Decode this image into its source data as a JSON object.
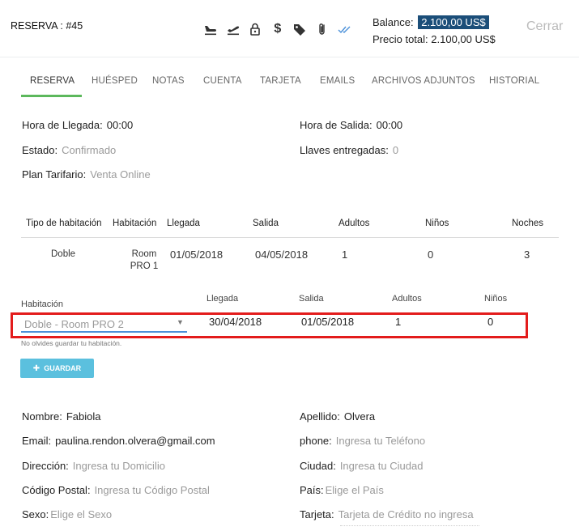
{
  "header": {
    "title": "RESERVA : #45",
    "icons": [
      "plane-landing-icon",
      "plane-takeoff-icon",
      "lock-icon",
      "dollar-icon",
      "tags-icon",
      "paperclip-icon",
      "double-check-icon"
    ],
    "balance_label": "Balance:",
    "balance_value": "2.100,00 US$",
    "total_label": "Precio total:",
    "total_value": "2.100,00 US$",
    "close_label": "Cerrar"
  },
  "tabs": [
    "RESERVA",
    "HUÉSPED",
    "NOTAS",
    "CUENTA",
    "TARJETA",
    "EMAILS",
    "ARCHIVOS ADJUNTOS",
    "HISTORIAL"
  ],
  "reservation": {
    "arrival_time_label": "Hora de Llegada:",
    "arrival_time": "00:00",
    "departure_time_label": "Hora de Salida:",
    "departure_time": "00:00",
    "status_label": "Estado:",
    "status": "Confirmado",
    "keys_label": "Llaves entregadas:",
    "keys": "0",
    "rate_plan_label": "Plan Tarifario:",
    "rate_plan": "Venta Online"
  },
  "rooms_table": {
    "headers": [
      "Tipo de habitación",
      "Habitación",
      "Llegada",
      "Salida",
      "Adultos",
      "Niños",
      "Noches"
    ],
    "rows": [
      {
        "type": "Doble",
        "room_line1": "Room",
        "room_line2": "PRO 1",
        "arrival": "01/05/2018",
        "departure": "04/05/2018",
        "adults": "1",
        "children": "0",
        "nights": "3"
      }
    ]
  },
  "edit_room": {
    "room_label": "Habitación",
    "arrival_label": "Llegada",
    "departure_label": "Salida",
    "adults_label": "Adultos",
    "children_label": "Niños",
    "room_value": "Doble - Room PRO 2",
    "arrival": "30/04/2018",
    "departure": "01/05/2018",
    "adults": "1",
    "children": "0",
    "hint": "No olvides guardar tu habitación.",
    "save_label": "GUARDAR"
  },
  "guest": {
    "name_label": "Nombre:",
    "name": "Fabiola",
    "surname_label": "Apellido:",
    "surname": "Olvera",
    "email_label": "Email:",
    "email": "paulina.rendon.olvera@gmail.com",
    "phone_label": "phone:",
    "phone_placeholder": "Ingresa tu Teléfono",
    "address_label": "Dirección:",
    "address_placeholder": "Ingresa tu Domicilio",
    "city_label": "Ciudad:",
    "city_placeholder": "Ingresa tu Ciudad",
    "zip_label": "Código Postal:",
    "zip_placeholder": "Ingresa tu Código Postal",
    "country_label": "País:",
    "country_placeholder": "Elige el País",
    "sex_label": "Sexo:",
    "sex_placeholder": "Elige el Sexo",
    "card_label": "Tarjeta:",
    "card_placeholder": "Tarjeta de Crédito no ingresa"
  },
  "colors": {
    "accent_green": "#5cb85c",
    "badge_blue": "#1b4e79",
    "button_blue": "#5bc0de",
    "highlight_red": "#e31c1c",
    "check_blue": "#4a90d9"
  }
}
